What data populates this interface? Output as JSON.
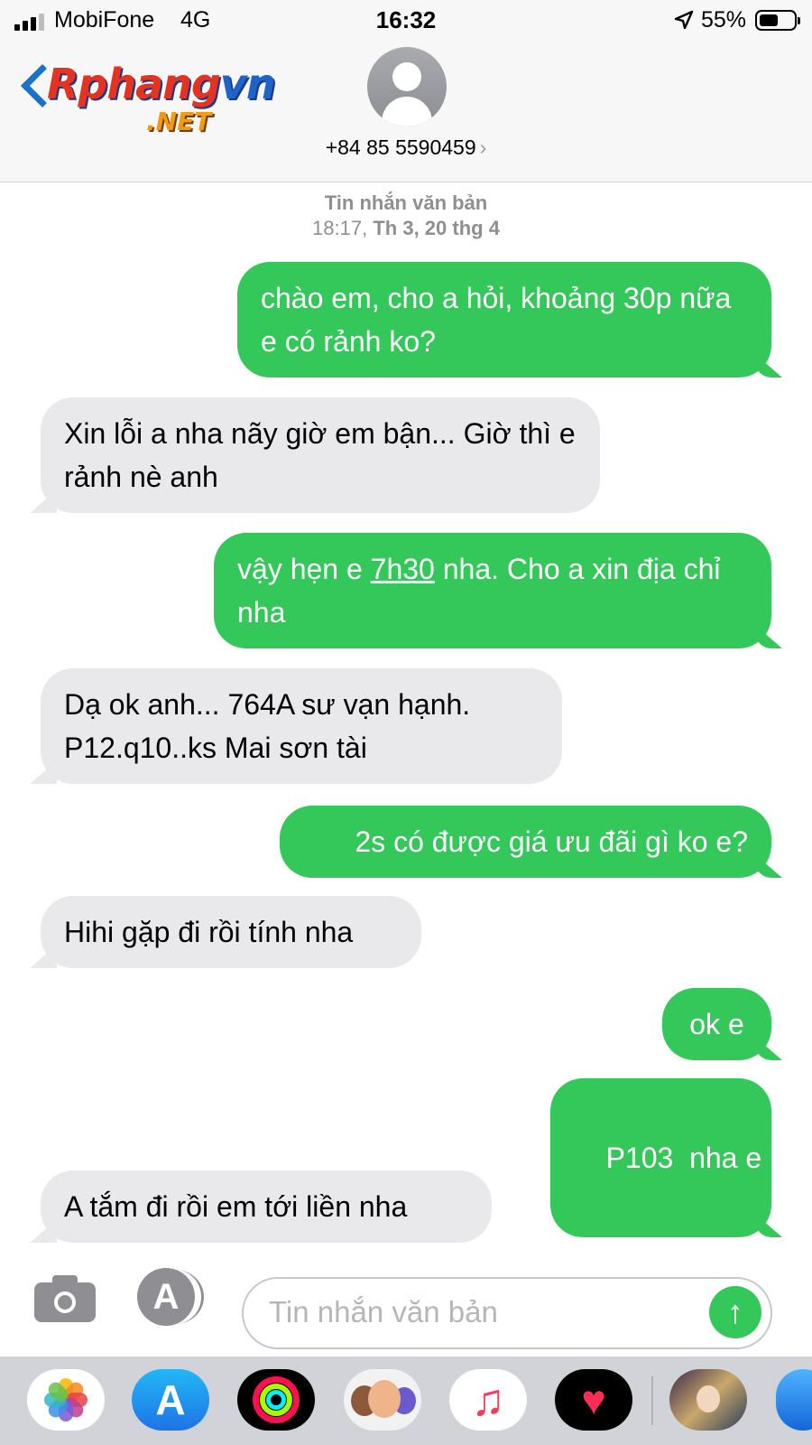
{
  "status_bar": {
    "carrier": "MobiFone",
    "network": "4G",
    "time": "16:32",
    "battery_percent_label": "55%",
    "battery_level": 0.55,
    "signal_bars_filled": 3,
    "icons": [
      "signal-icon",
      "location-arrow-icon",
      "battery-icon"
    ]
  },
  "header": {
    "logo_text_red": "Rphang",
    "logo_text_blue": "vn",
    "logo_tld": ".NET",
    "contact_number": "+84 85 5590459",
    "contact_chevron": "›"
  },
  "thread": {
    "meta_label": "Tin nhắn văn bản",
    "meta_time": "18:17,",
    "meta_date": "Th 3, 20 thg 4",
    "messages": [
      {
        "direction": "out",
        "text": "chào em, cho a hỏi, khoảng 30p nữa e có rảnh ko?"
      },
      {
        "direction": "in",
        "text": "Xin lỗi a nha nãy giờ em bận... Giờ thì e rảnh nè anh"
      },
      {
        "direction": "out",
        "text_before": "vậy hẹn e ",
        "link": "7h30",
        "text_after": " nha. Cho a xin địa chỉ nha"
      },
      {
        "direction": "in",
        "text": "Dạ ok anh... 764A sư vạn hạnh. P12.q10..ks Mai sơn tài"
      },
      {
        "direction": "out",
        "text": "2s có được giá ưu đãi gì ko e?"
      },
      {
        "direction": "in",
        "text": "Hihi gặp đi rồi tính nha"
      },
      {
        "direction": "out",
        "text": "ok e"
      },
      {
        "direction": "out",
        "text": "P103  nha e"
      },
      {
        "direction": "in",
        "text": "A tắm đi rồi em tới liền nha"
      }
    ]
  },
  "input_bar": {
    "placeholder": "Tin nhắn văn bản",
    "camera_icon": "camera-icon",
    "apps_icon": "app-store-icon",
    "send_icon": "send-arrow-icon",
    "send_glyph": "↑",
    "apps_glyph": "A"
  },
  "dock": {
    "apps": [
      "photos-app-icon",
      "app-store-app-icon",
      "activity-app-icon",
      "memoji-app-icon",
      "music-app-icon",
      "health-app-icon",
      "game-app-icon",
      "more-app-icon"
    ],
    "app_store_glyph": "A",
    "music_glyph": "♫",
    "heart_glyph": "♥"
  },
  "colors": {
    "outgoing_bubble": "#34c759",
    "incoming_bubble": "#e9e9eb",
    "meta_text": "#8e8e93",
    "dock_background": "#d1d3d9"
  }
}
